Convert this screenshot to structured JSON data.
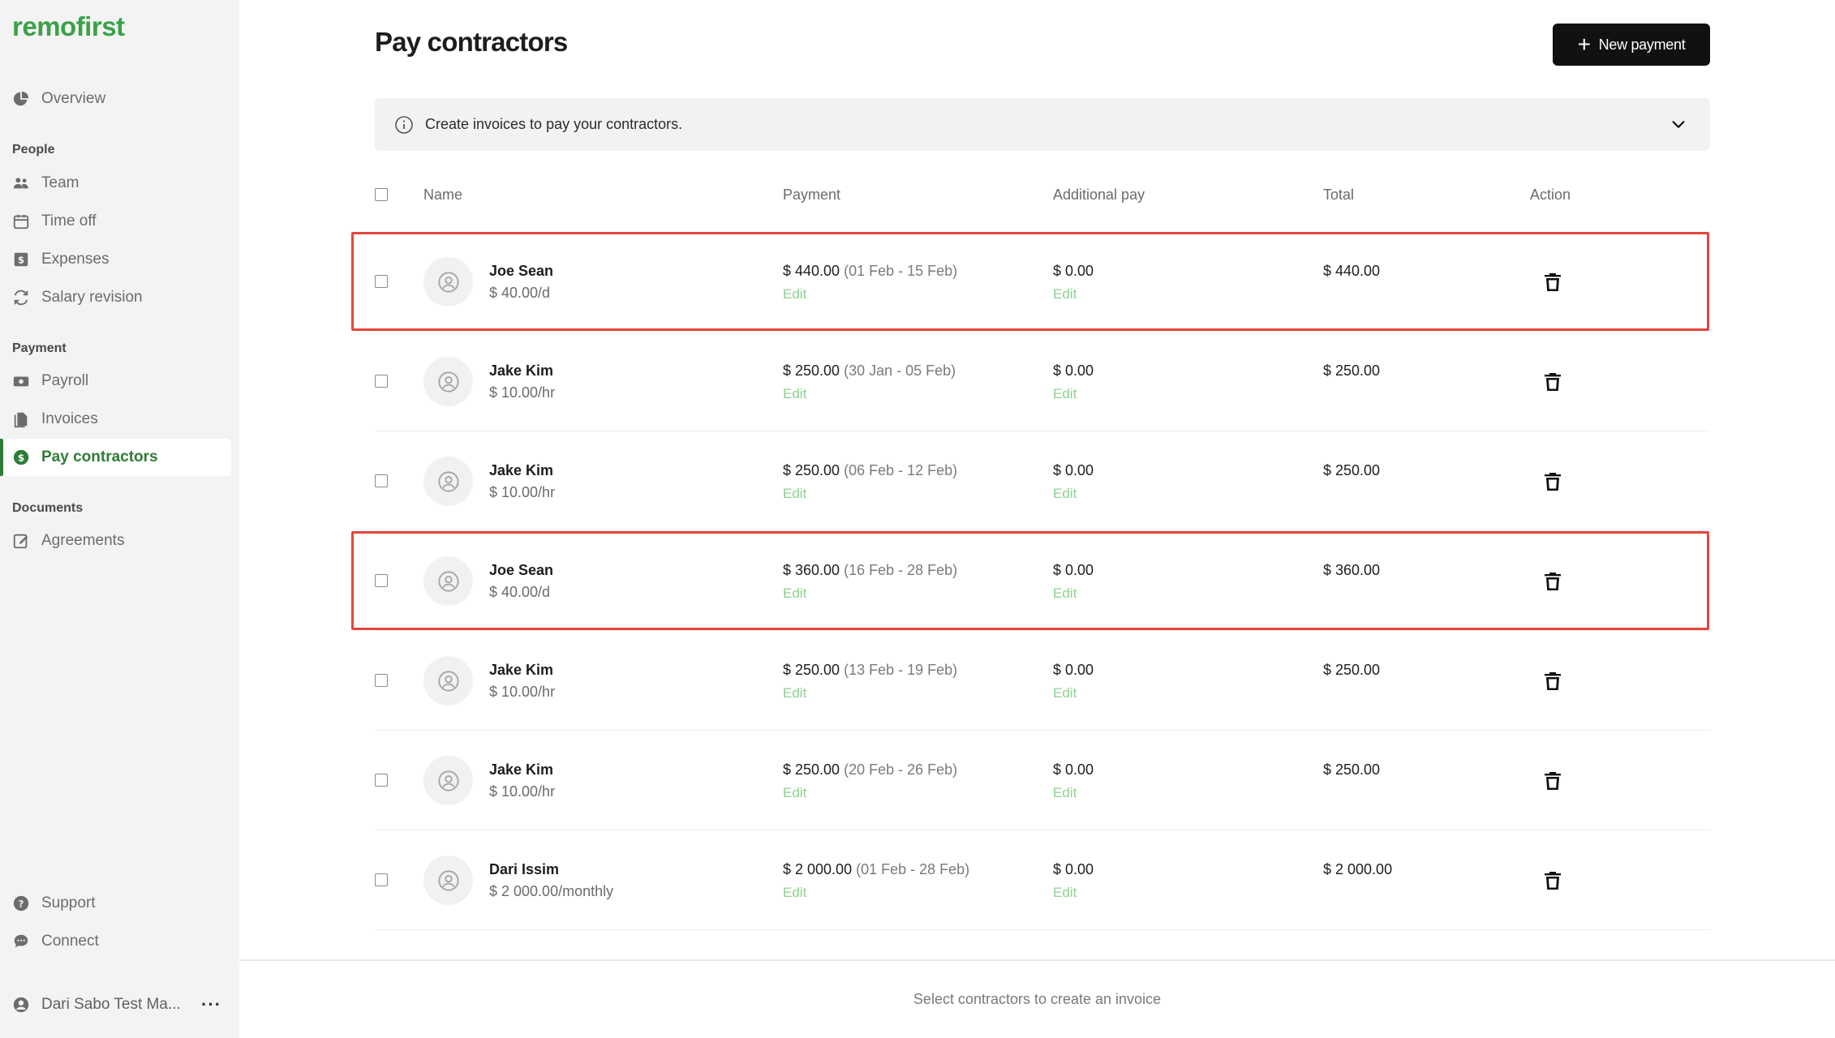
{
  "brand": {
    "logo": "remofirst",
    "accent_color": "#3aa147",
    "active_color": "#2e7d36"
  },
  "sidebar": {
    "overview": "Overview",
    "sections": {
      "people": "People",
      "payment": "Payment",
      "documents": "Documents"
    },
    "people_items": [
      {
        "label": "Team",
        "icon": "team-icon"
      },
      {
        "label": "Time off",
        "icon": "calendar-icon"
      },
      {
        "label": "Expenses",
        "icon": "expenses-icon"
      },
      {
        "label": "Salary revision",
        "icon": "revision-icon"
      }
    ],
    "payment_items": [
      {
        "label": "Payroll",
        "icon": "payroll-icon"
      },
      {
        "label": "Invoices",
        "icon": "invoices-icon"
      },
      {
        "label": "Pay contractors",
        "icon": "dollar-icon",
        "active": true
      }
    ],
    "documents_items": [
      {
        "label": "Agreements",
        "icon": "edit-icon"
      }
    ],
    "bottom_items": [
      {
        "label": "Support",
        "icon": "help-icon"
      },
      {
        "label": "Connect",
        "icon": "chat-icon"
      }
    ],
    "user": {
      "name": "Dari Sabo Test Ma...",
      "more": "···"
    }
  },
  "header": {
    "title": "Pay contractors",
    "new_payment_label": "New payment"
  },
  "banner": {
    "text": "Create invoices to pay your contractors."
  },
  "table": {
    "columns": {
      "name": "Name",
      "payment": "Payment",
      "additional": "Additional pay",
      "total": "Total",
      "action": "Action"
    },
    "edit_label": "Edit",
    "rows": [
      {
        "name": "Joe Sean",
        "rate": "$ 40.00/d",
        "payment": "$ 440.00",
        "period": "(01 Feb - 15 Feb)",
        "additional": "$ 0.00",
        "total": "$ 440.00",
        "highlighted": true
      },
      {
        "name": "Jake Kim",
        "rate": "$ 10.00/hr",
        "payment": "$ 250.00",
        "period": "(30 Jan - 05 Feb)",
        "additional": "$ 0.00",
        "total": "$ 250.00",
        "highlighted": false
      },
      {
        "name": "Jake Kim",
        "rate": "$ 10.00/hr",
        "payment": "$ 250.00",
        "period": "(06 Feb - 12 Feb)",
        "additional": "$ 0.00",
        "total": "$ 250.00",
        "highlighted": false
      },
      {
        "name": "Joe Sean",
        "rate": "$ 40.00/d",
        "payment": "$ 360.00",
        "period": "(16 Feb - 28 Feb)",
        "additional": "$ 0.00",
        "total": "$ 360.00",
        "highlighted": true
      },
      {
        "name": "Jake Kim",
        "rate": "$ 10.00/hr",
        "payment": "$ 250.00",
        "period": "(13 Feb - 19 Feb)",
        "additional": "$ 0.00",
        "total": "$ 250.00",
        "highlighted": false
      },
      {
        "name": "Jake Kim",
        "rate": "$ 10.00/hr",
        "payment": "$ 250.00",
        "period": "(20 Feb - 26 Feb)",
        "additional": "$ 0.00",
        "total": "$ 250.00",
        "highlighted": false
      },
      {
        "name": "Dari Issim",
        "rate": "$ 2 000.00/monthly",
        "payment": "$ 2 000.00",
        "period": "(01 Feb - 28 Feb)",
        "additional": "$ 0.00",
        "total": "$ 2 000.00",
        "highlighted": false
      }
    ]
  },
  "footer": {
    "text": "Select contractors to create an invoice"
  }
}
